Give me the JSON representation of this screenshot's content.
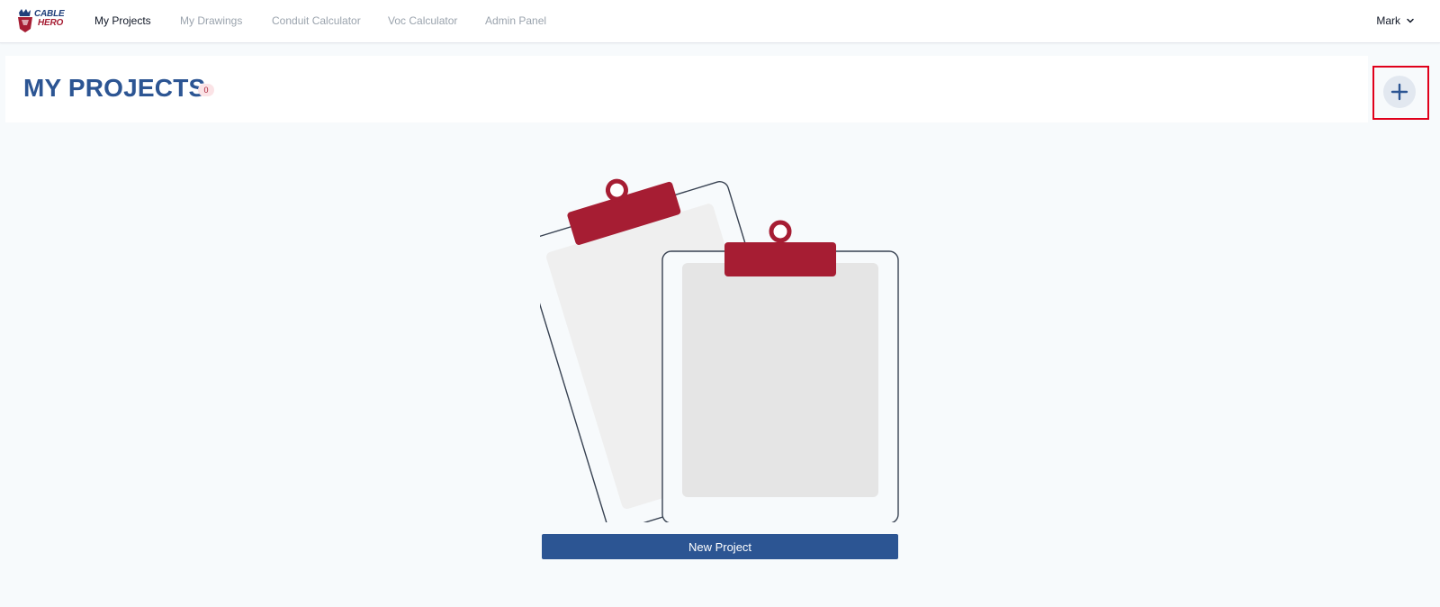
{
  "brand": {
    "logo_line1": "CABLE",
    "logo_line2": "HERO",
    "primary_color": "#2c5593",
    "accent_color": "#a61d33"
  },
  "nav": {
    "items": [
      {
        "label": "My Projects",
        "active": true
      },
      {
        "label": "My Drawings",
        "active": false
      },
      {
        "label": "Conduit Calculator",
        "active": false
      },
      {
        "label": "Voc Calculator",
        "active": false
      },
      {
        "label": "Admin Panel",
        "active": false
      }
    ]
  },
  "user": {
    "name": "Mark",
    "icon": "chevron-down-icon"
  },
  "page": {
    "title": "MY PROJECTS",
    "project_count": "0",
    "add_icon": "plus-icon"
  },
  "empty_state": {
    "illustration": "clipboards-illustration",
    "button_label": "New Project"
  }
}
